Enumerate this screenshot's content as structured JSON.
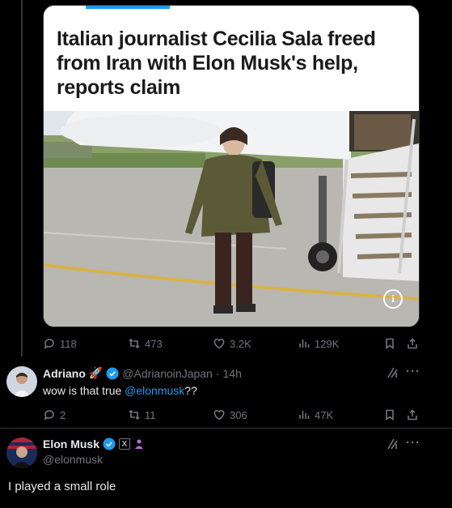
{
  "card": {
    "headline": "Italian journalist Cecilia Sala freed from Iran with Elon Musk's help, reports claim"
  },
  "post_actions": {
    "replies": "118",
    "reposts": "473",
    "likes": "3.2K",
    "views": "129K"
  },
  "reply": {
    "display_name": "Adriano",
    "emoji": "🚀",
    "handle": "@AdrianoinJapan",
    "dot": "·",
    "time": "14h",
    "text_before": "wow is that true ",
    "mention": "@elonmusk",
    "text_after": "??",
    "actions": {
      "replies": "2",
      "reposts": "11",
      "likes": "306",
      "views": "47K"
    }
  },
  "response": {
    "display_name": "Elon Musk",
    "handle": "@elonmusk",
    "text": "I played a small role"
  },
  "icons": {
    "info": "i",
    "x_badge": "X",
    "more": "···",
    "grok": "grok-icon"
  },
  "colors": {
    "accent": "#1d9bf0",
    "muted": "#71767b",
    "background": "#000000",
    "text": "#e7e9ea"
  }
}
